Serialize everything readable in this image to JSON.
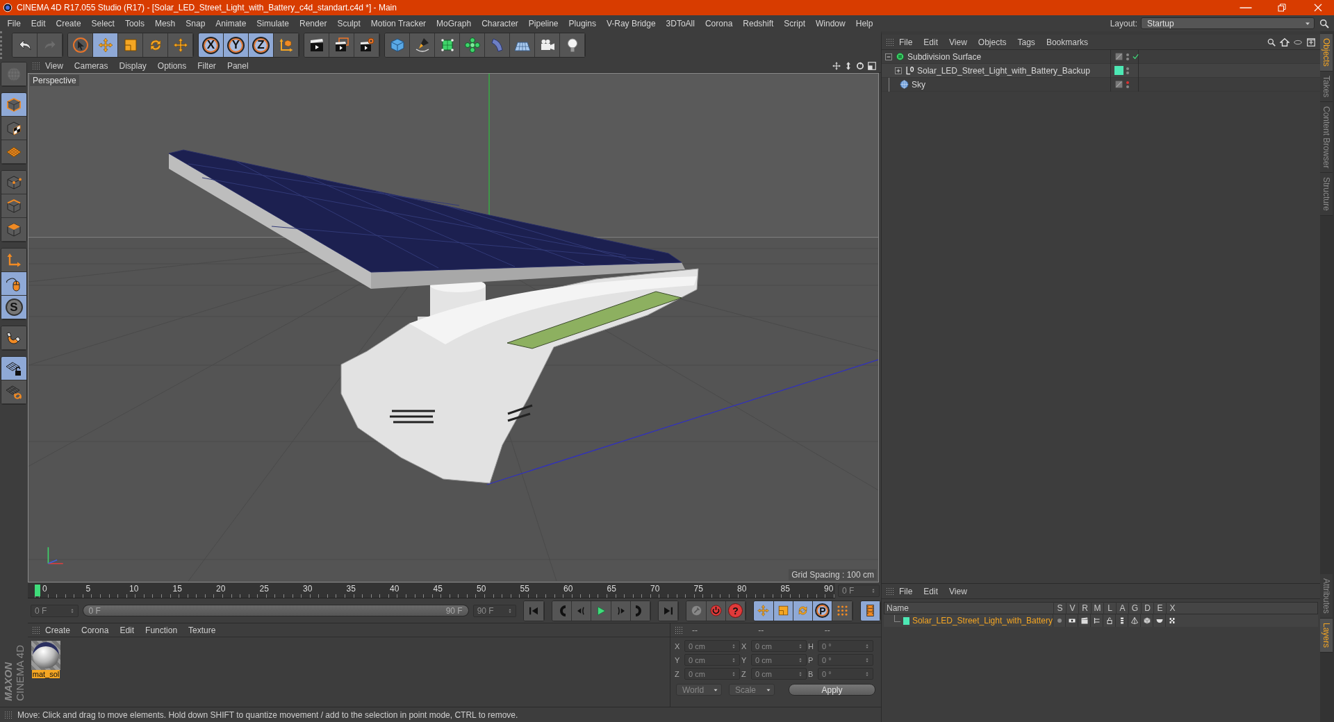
{
  "window": {
    "title": "CINEMA 4D R17.055 Studio (R17) - [Solar_LED_Street_Light_with_Battery_c4d_standart.c4d *] - Main"
  },
  "menu": [
    "File",
    "Edit",
    "Create",
    "Select",
    "Tools",
    "Mesh",
    "Snap",
    "Animate",
    "Simulate",
    "Render",
    "Sculpt",
    "Motion Tracker",
    "MoGraph",
    "Character",
    "Pipeline",
    "Plugins",
    "V-Ray Bridge",
    "3DToAll",
    "Corona",
    "Redshift",
    "Script",
    "Window",
    "Help"
  ],
  "layout": {
    "label": "Layout:",
    "value": "Startup"
  },
  "main_toolbar": [
    {
      "active": false,
      "disabled": false
    },
    {
      "active": false,
      "disabled": true
    },
    {
      "active": false,
      "disabled": false
    },
    {
      "active": true,
      "disabled": false
    },
    {
      "active": false,
      "disabled": false
    },
    {
      "active": false,
      "disabled": false
    },
    {
      "active": false,
      "disabled": false
    },
    {
      "active": true,
      "disabled": false,
      "label": "X"
    },
    {
      "active": true,
      "disabled": false,
      "label": "Y"
    },
    {
      "active": true,
      "disabled": false,
      "label": "Z"
    },
    {
      "active": false,
      "disabled": false
    },
    {
      "active": false,
      "disabled": false
    },
    {
      "active": false,
      "disabled": false
    },
    {
      "active": false,
      "disabled": false
    },
    {
      "active": false,
      "disabled": false
    },
    {
      "active": false,
      "disabled": false
    },
    {
      "active": false,
      "disabled": false
    },
    {
      "active": false,
      "disabled": false
    },
    {
      "active": false,
      "disabled": false
    },
    {
      "active": false,
      "disabled": false
    },
    {
      "active": false,
      "disabled": false
    },
    {
      "active": false,
      "disabled": false
    }
  ],
  "left_tools": [
    {
      "active": false,
      "disabled": true
    },
    {
      "active": true,
      "disabled": false
    },
    {
      "active": false,
      "disabled": false
    },
    {
      "active": false,
      "disabled": false
    },
    {
      "active": false,
      "disabled": false
    },
    {
      "active": false,
      "disabled": false
    },
    {
      "active": false,
      "disabled": false
    },
    {
      "active": false,
      "disabled": false
    },
    {
      "active": true,
      "disabled": false
    },
    {
      "active": true,
      "disabled": false,
      "label": "S"
    },
    {
      "active": false,
      "disabled": false
    },
    {
      "active": true,
      "disabled": false
    },
    {
      "active": false,
      "disabled": false
    }
  ],
  "logo": {
    "brand": "MAXON",
    "product": "CINEMA 4D"
  },
  "viewport": {
    "menu": [
      "View",
      "Cameras",
      "Display",
      "Options",
      "Filter",
      "Panel"
    ],
    "camera": "Perspective",
    "grid_spacing": "Grid Spacing : 100 cm"
  },
  "timeline": {
    "ticks": [
      "0",
      "5",
      "10",
      "15",
      "20",
      "25",
      "30",
      "35",
      "40",
      "45",
      "50",
      "55",
      "60",
      "65",
      "70",
      "75",
      "80",
      "85",
      "90"
    ],
    "playhead": {
      "level": 0
    },
    "current_frame": "0 F",
    "start_field": "0 F",
    "range_slider": {
      "start": "0 F",
      "end": "90 F",
      "level": 1
    },
    "end_field": "90 F"
  },
  "key_tools": [
    {
      "active": false
    },
    {
      "active": false
    },
    {
      "active": false,
      "label": "?"
    },
    {
      "active": true
    },
    {
      "active": true
    },
    {
      "active": true
    },
    {
      "active": true,
      "label": "P"
    },
    {
      "active": false
    },
    {
      "active": true
    }
  ],
  "materials": {
    "menu": [
      "Create",
      "Corona",
      "Edit",
      "Function",
      "Texture"
    ],
    "items": [
      {
        "name": "mat_sol",
        "selected": true
      }
    ]
  },
  "coordinates": {
    "headers": [
      "--",
      "--",
      "--"
    ],
    "rows": [
      {
        "axis": "X",
        "position": "0 cm",
        "size_axis": "X",
        "size": "0 cm",
        "rotation_axis": "H",
        "rotation": "0 °"
      },
      {
        "axis": "Y",
        "position": "0 cm",
        "size_axis": "Y",
        "size": "0 cm",
        "rotation_axis": "P",
        "rotation": "0 °"
      },
      {
        "axis": "Z",
        "position": "0 cm",
        "size_axis": "Z",
        "size": "0 cm",
        "rotation_axis": "B",
        "rotation": "0 °"
      }
    ],
    "mode": "World",
    "size_mode": "Scale",
    "apply": "Apply"
  },
  "status_bar": "Move: Click and drag to move elements. Hold down SHIFT to quantize movement / add to the selection in point mode, CTRL to remove.",
  "objects": {
    "menu": [
      "File",
      "Edit",
      "View",
      "Objects",
      "Tags",
      "Bookmarks"
    ],
    "tree": [
      {
        "name": "Subdivision Surface",
        "kind": "subdivision",
        "expanded": true,
        "editor_visible": true,
        "enabled": true,
        "children": [
          {
            "name": "Solar_LED_Street_Light_with_Battery_Backup",
            "kind": "null",
            "expanded": false,
            "editor_visible": true,
            "color": "#4de8b4"
          }
        ]
      },
      {
        "name": "Sky",
        "kind": "sky",
        "editor_visible": false
      }
    ]
  },
  "layers": {
    "menu": [
      "File",
      "Edit",
      "View"
    ],
    "columns": [
      "Name",
      "S",
      "V",
      "R",
      "M",
      "L",
      "A",
      "G",
      "D",
      "E",
      "X"
    ],
    "rows": [
      {
        "name": "Solar_LED_Street_Light_with_Battery",
        "color": "#4de8b4",
        "selected": true
      }
    ]
  },
  "side_tabs": {
    "top": [
      {
        "label": "Objects",
        "selected": true
      },
      {
        "label": "Takes",
        "selected": false
      },
      {
        "label": "Content Browser",
        "selected": false
      },
      {
        "label": "Structure",
        "selected": false
      }
    ],
    "bottom": [
      {
        "label": "Attributes",
        "selected": false
      },
      {
        "label": "Layers",
        "selected": true
      }
    ]
  }
}
